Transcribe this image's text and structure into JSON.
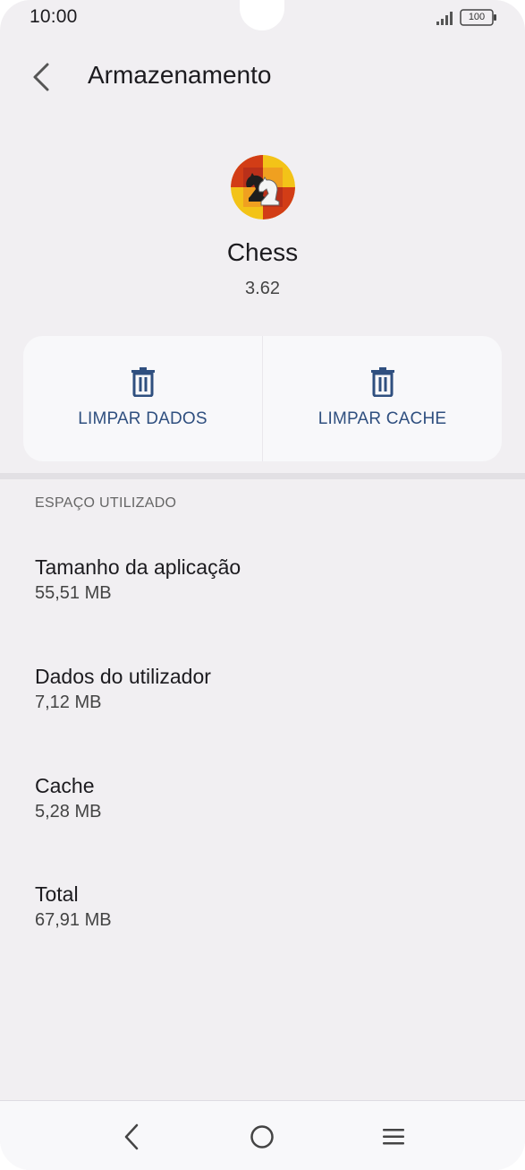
{
  "status_bar": {
    "time": "10:00",
    "battery": "100",
    "signal_icon": "signal-icon",
    "battery_icon": "battery-icon"
  },
  "app_bar": {
    "title": "Armazenamento",
    "back_icon": "back-arrow-icon"
  },
  "app": {
    "name": "Chess",
    "version": "3.62",
    "icon": "chess-knight-icon"
  },
  "actions": {
    "clear_data": "LIMPAR DADOS",
    "clear_cache": "LIMPAR CACHE",
    "icon": "trash-icon"
  },
  "storage": {
    "section_title": "ESPAÇO UTILIZADO",
    "items": [
      {
        "label": "Tamanho da aplicação",
        "value": "55,51 MB"
      },
      {
        "label": "Dados do utilizador",
        "value": "7,12 MB"
      },
      {
        "label": "Cache",
        "value": "5,28 MB"
      },
      {
        "label": "Total",
        "value": "67,91 MB"
      }
    ]
  },
  "nav_bar": {
    "back_icon": "nav-back-icon",
    "home_icon": "nav-home-icon",
    "recents_icon": "nav-menu-icon"
  },
  "colors": {
    "background": "#f1eff2",
    "card": "#f8f8fa",
    "accent": "#2f4f7f",
    "divider": "#e2e0e4"
  }
}
